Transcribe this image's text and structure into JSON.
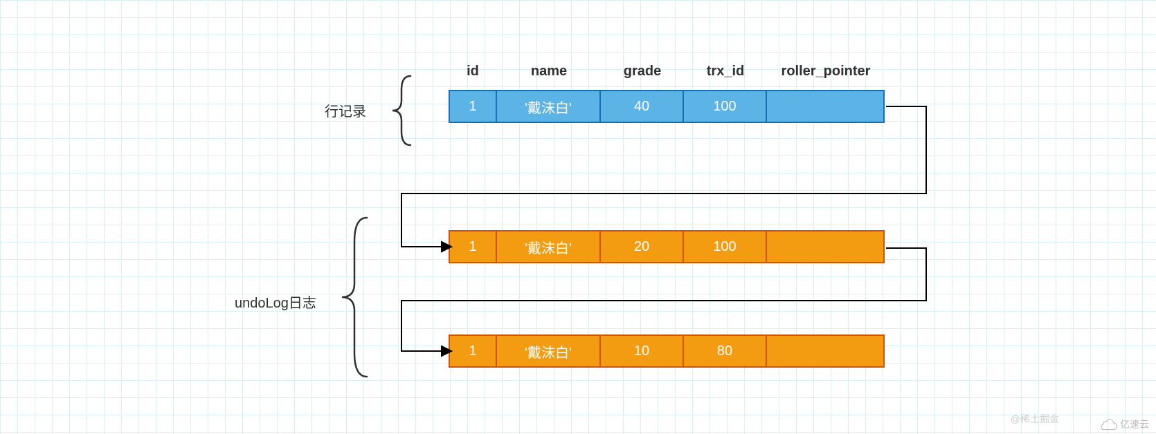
{
  "headers": {
    "id": "id",
    "name": "name",
    "grade": "grade",
    "trx_id": "trx_id",
    "roller_pointer": "roller_pointer"
  },
  "labels": {
    "row_record": "行记录",
    "undo_log": "undoLog日志"
  },
  "rows": [
    {
      "id": "1",
      "name": "'戴沫白'",
      "grade": "40",
      "trx_id": "100",
      "roller_pointer": ""
    },
    {
      "id": "1",
      "name": "'戴沫白'",
      "grade": "20",
      "trx_id": "100",
      "roller_pointer": ""
    },
    {
      "id": "1",
      "name": "'戴沫白'",
      "grade": "10",
      "trx_id": "80",
      "roller_pointer": ""
    }
  ],
  "watermarks": {
    "left": "@稀土掘金",
    "right": "亿速云"
  }
}
